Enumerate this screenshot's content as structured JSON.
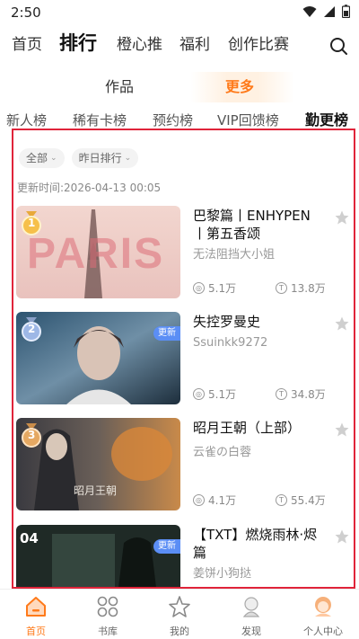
{
  "status_bar": {
    "time": "2:50"
  },
  "top_nav": {
    "tabs": [
      "首页",
      "排行",
      "橙心推",
      "福利",
      "创作比赛"
    ],
    "active_index": 1
  },
  "sub_tabs": {
    "items": [
      "作品",
      "更多"
    ],
    "active_index": 1
  },
  "rank_tabs": {
    "items": [
      "新人榜",
      "稀有卡榜",
      "预约榜",
      "VIP回馈榜",
      "勤更榜"
    ],
    "active_index": 4
  },
  "filters": {
    "scope": "全部",
    "sort": "昨日排行"
  },
  "update_time": {
    "label": "更新时间:",
    "value": "2026-04-13 00:05"
  },
  "books": [
    {
      "rank": "1",
      "title": "巴黎篇丨ENHYPEN丨第五香颂",
      "author": "无法阻挡大小姐",
      "stat1": "5.1万",
      "stat2": "13.8万",
      "cover_text": "PARIS",
      "is_new": false,
      "new_label": ""
    },
    {
      "rank": "2",
      "title": "失控罗曼史",
      "author": "Ssuinkk9272",
      "stat1": "5.1万",
      "stat2": "34.8万",
      "cover_text": "",
      "is_new": true,
      "new_label": "更新"
    },
    {
      "rank": "3",
      "title": "昭月王朝（上部）",
      "author": "云雀の白蓉",
      "stat1": "4.1万",
      "stat2": "55.4万",
      "cover_text": "昭月王朝",
      "is_new": false,
      "new_label": ""
    },
    {
      "rank": "04",
      "title": "【TXT】燃烧雨林·烬篇",
      "author": "姜饼小狗挞",
      "stat1": "",
      "stat2": "",
      "cover_text": "",
      "is_new": true,
      "new_label": "更新"
    }
  ],
  "bottom_nav": {
    "items": [
      "首页",
      "书库",
      "我的",
      "发现",
      "个人中心"
    ],
    "active_index": 0
  },
  "colors": {
    "accent": "#ff7a1a",
    "frame": "#e0243a",
    "badge": "#5b8ef5"
  }
}
